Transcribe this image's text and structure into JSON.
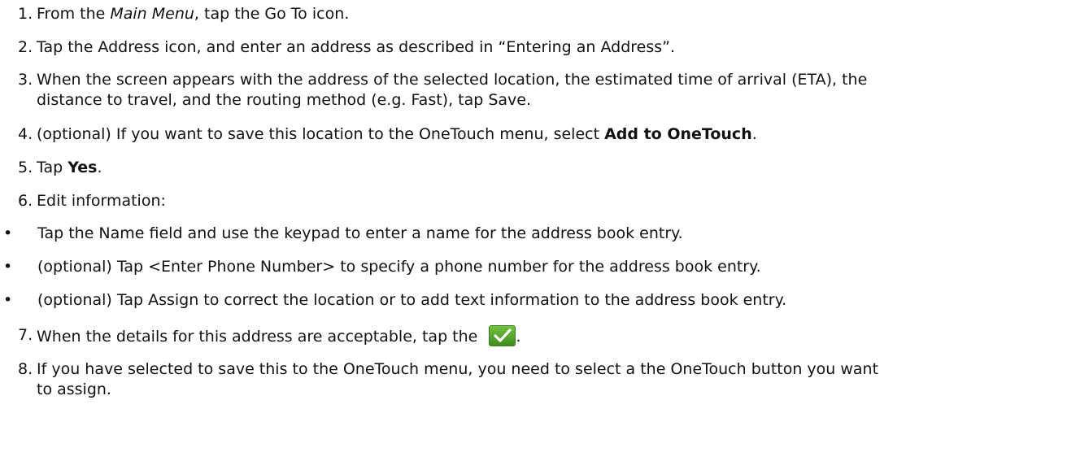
{
  "steps": [
    {
      "num": "1.",
      "pre": "From the ",
      "em": "Main Menu",
      "post": ", tap the Go To icon."
    },
    {
      "num": "2.",
      "text": "Tap the Address icon, and enter an address as described in “Entering an Address”."
    },
    {
      "num": "3.",
      "line1": "When the screen appears with the address of the selected location, the estimated time of arrival (ETA), the",
      "line2": "distance to travel, and the routing method (e.g. Fast), tap Save."
    },
    {
      "num": "4.",
      "pre": "(optional) If you want to save this location to the OneTouch menu, select ",
      "strong": "Add to OneTouch",
      "post": "."
    },
    {
      "num": "5.",
      "pre": "Tap ",
      "strong": "Yes",
      "post": "."
    },
    {
      "num": "6.",
      "text": "Edit information:"
    },
    {
      "num": "7.",
      "pre": "When the details for this address are acceptable, tap the ",
      "post": "."
    },
    {
      "num": "8.",
      "line1": "If you have selected to save this to the OneTouch menu, you need to select a the OneTouch button you want",
      "line2": "to assign."
    }
  ],
  "bullets": [
    {
      "mark": "•",
      "text": "Tap the Name field and use the keypad to enter a name for the address book entry."
    },
    {
      "mark": "•",
      "text": "(optional) Tap <Enter Phone Number> to specify a phone number for the address book entry."
    },
    {
      "mark": "•",
      "text": "(optional) Tap Assign to correct the location or to add text information to the address book entry."
    }
  ],
  "icons": {
    "confirm": "checkmark-icon",
    "confirm_color": "#4fa52c"
  }
}
